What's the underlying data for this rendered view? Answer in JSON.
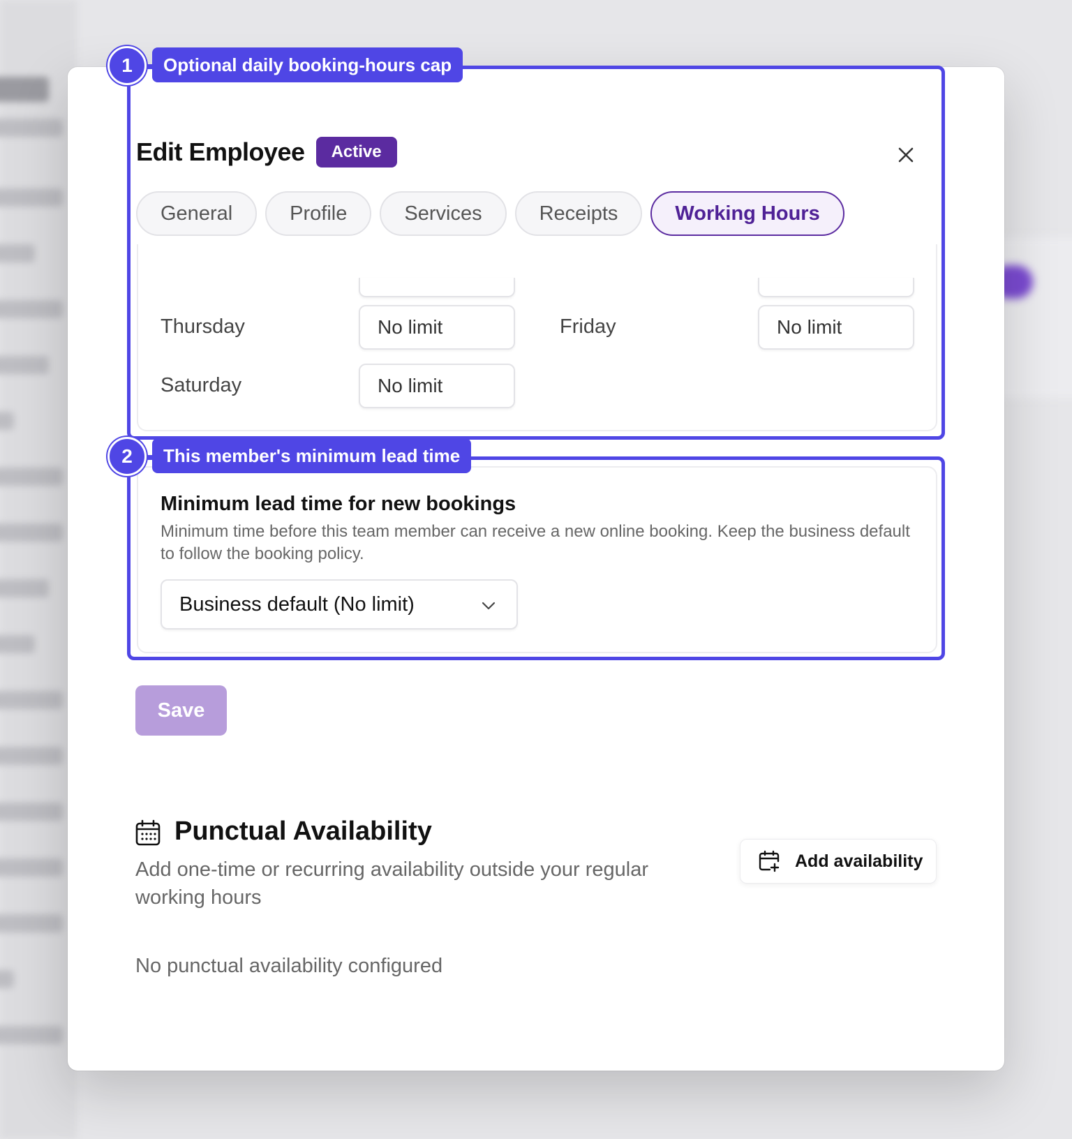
{
  "modal": {
    "title": "Edit Employee",
    "status": "Active"
  },
  "tabs": [
    {
      "label": "General",
      "active": false
    },
    {
      "label": "Profile",
      "active": false
    },
    {
      "label": "Services",
      "active": false
    },
    {
      "label": "Receipts",
      "active": false
    },
    {
      "label": "Working Hours",
      "active": true
    }
  ],
  "daily_hours": {
    "thursday": {
      "label": "Thursday",
      "value": "No limit"
    },
    "friday": {
      "label": "Friday",
      "value": "No limit"
    },
    "saturday": {
      "label": "Saturday",
      "value": "No limit"
    }
  },
  "lead_time": {
    "title": "Minimum lead time for new bookings",
    "description": "Minimum time before this team member can receive a new online booking. Keep the business default to follow the booking policy.",
    "selected": "Business default (No limit)"
  },
  "save_label": "Save",
  "punctual_availability": {
    "title": "Punctual Availability",
    "description": "Add one-time or recurring availability outside your regular working hours",
    "add_label": "Add availability",
    "empty_text": "No punctual availability configured"
  },
  "annotations": [
    {
      "number": "1",
      "label": "Optional daily booking-hours cap"
    },
    {
      "number": "2",
      "label": "This member's minimum lead time"
    }
  ],
  "colors": {
    "brand_purple": "#5b2ba0",
    "annotation_blue": "#4f46e5",
    "save_disabled": "#b79ddb"
  }
}
